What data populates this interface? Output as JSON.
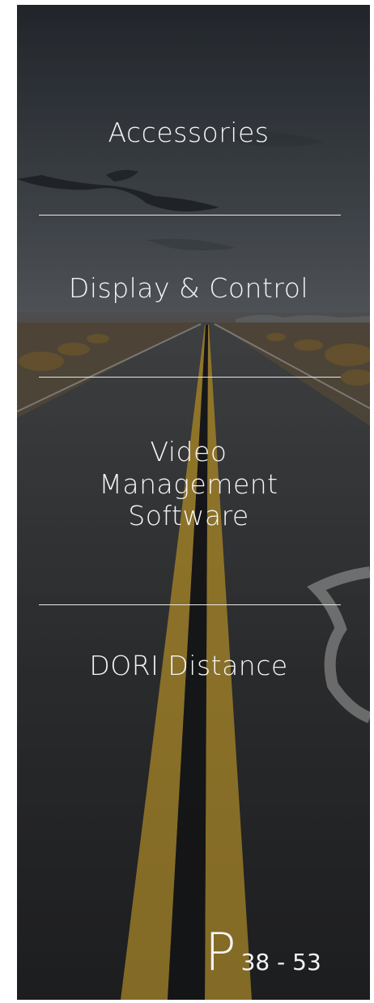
{
  "menu": {
    "accessories": "Accessories",
    "display_control": "Display & Control",
    "vms_line1": "Video",
    "vms_line2": "Management",
    "vms_line3": "Software",
    "dori": "DORI Distance"
  },
  "page_ref": {
    "letter": "P",
    "range": "38 - 53"
  },
  "background_image": {
    "subject": "desert highway with double yellow center line under cloudy sky"
  },
  "colors": {
    "text": "#f4f4f4",
    "divider": "#e8e8e8",
    "road_line": "#c9a33a"
  }
}
